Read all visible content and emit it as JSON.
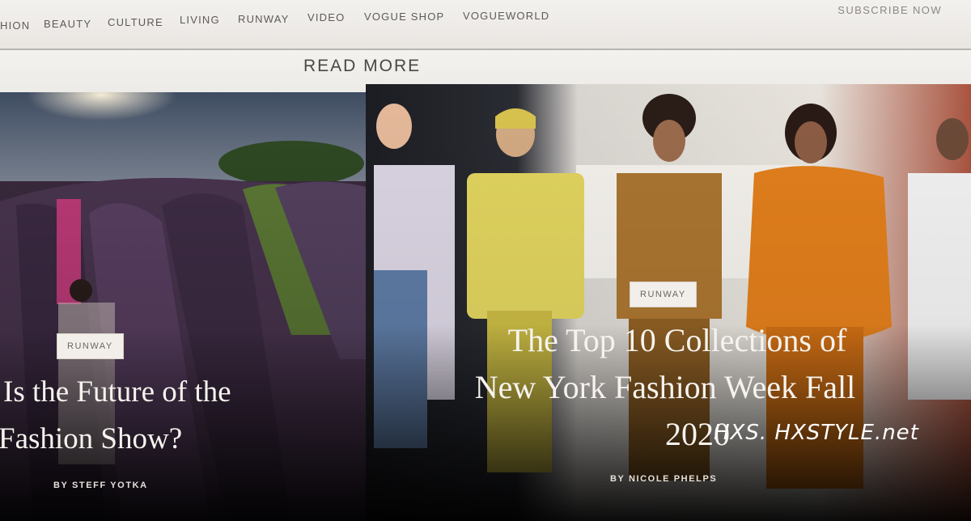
{
  "nav": {
    "items": [
      "HION",
      "BEAUTY",
      "CULTURE",
      "LIVING",
      "RUNWAY",
      "VIDEO",
      "VOGUE SHOP",
      "VOGUEWORLD"
    ],
    "subscribe": "SUBSCRIBE NOW"
  },
  "read_more": "READ MORE",
  "cards": [
    {
      "badge": "RUNWAY",
      "headline_line1": "Is the Future of the",
      "headline_line2": "Fashion Show?",
      "byline": "BY STEFF YOTKA"
    },
    {
      "badge": "RUNWAY",
      "headline_line1": "The Top 10 Collections of",
      "headline_line2": "New York Fashion Week Fall",
      "headline_line3": "2020",
      "byline": "BY NICOLE PHELPS"
    }
  ],
  "watermark": "HXS. HXSTYLE.net",
  "colors": {
    "nav_bg": "#f1efec",
    "page_bg": "#0d0b0c"
  }
}
